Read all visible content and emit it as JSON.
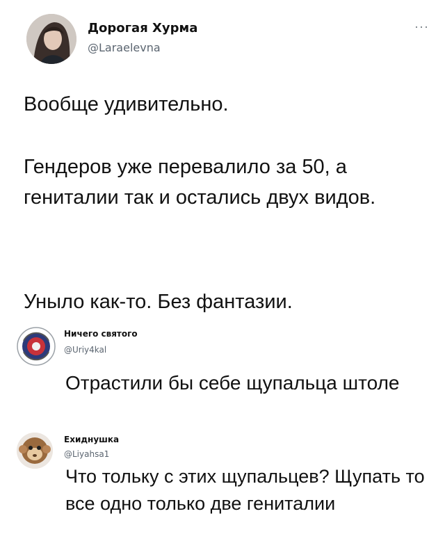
{
  "main_tweet": {
    "author_name": "Дорогая Хурма",
    "author_handle": "@Laraelevna",
    "more_label": "···",
    "paragraph_1": "Вообще удивительно.",
    "paragraph_2": "Гендеров уже перевалило за 50, а гениталии так и остались двух видов.",
    "paragraph_3": "Уныло как-то. Без фантазии."
  },
  "reply_1": {
    "author_name": "Ничего святого",
    "author_handle": "@Uriy4kal",
    "text": "Отрастили бы себе щупальца штоле"
  },
  "reply_2": {
    "author_name": "Ехиднушка",
    "author_handle": "@Liyahsa1",
    "text": "Что тольку с этих щупальцев? Щупать то все одно только две гениталии"
  },
  "icons": {
    "main_avatar": "user-photo-avatar",
    "reply_1_avatar": "emblem-avatar",
    "reply_2_avatar": "monkey-avatar",
    "more": "more-options-icon"
  }
}
